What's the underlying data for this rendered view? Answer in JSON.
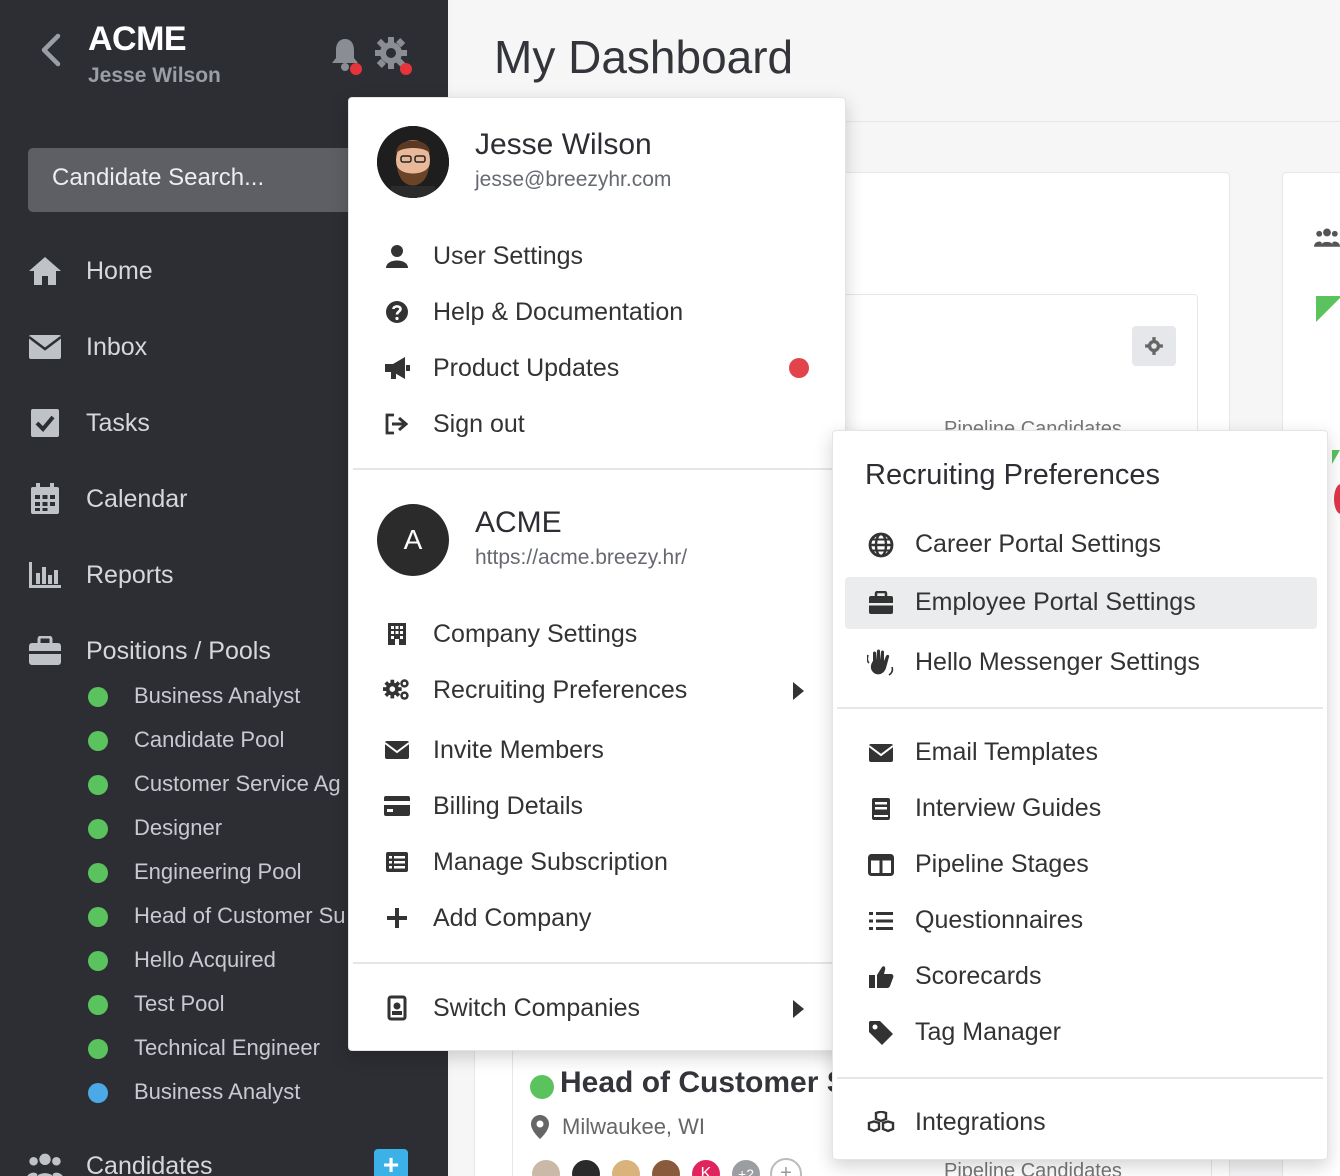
{
  "sidebar": {
    "company": "ACME",
    "user": "Jesse Wilson",
    "search_placeholder": "Candidate Search...",
    "nav": [
      {
        "label": "Home",
        "icon": "home-icon"
      },
      {
        "label": "Inbox",
        "icon": "envelope-icon"
      },
      {
        "label": "Tasks",
        "icon": "checkbox-icon"
      },
      {
        "label": "Calendar",
        "icon": "calendar-icon"
      },
      {
        "label": "Reports",
        "icon": "bar-chart-icon"
      },
      {
        "label": "Positions / Pools",
        "icon": "briefcase-icon"
      }
    ],
    "positions": [
      {
        "label": "Business Analyst",
        "color": "#5ac35e"
      },
      {
        "label": "Candidate Pool",
        "color": "#5ac35e"
      },
      {
        "label": "Customer Service Ag",
        "color": "#5ac35e"
      },
      {
        "label": "Designer",
        "color": "#5ac35e"
      },
      {
        "label": "Engineering Pool",
        "color": "#5ac35e"
      },
      {
        "label": "Head of Customer Su",
        "color": "#5ac35e"
      },
      {
        "label": "Hello Acquired",
        "color": "#5ac35e"
      },
      {
        "label": "Test Pool",
        "color": "#5ac35e"
      },
      {
        "label": "Technical Engineer",
        "color": "#5ac35e"
      },
      {
        "label": "Business Analyst",
        "color": "#4aa9e6"
      }
    ],
    "candidates_label": "Candidates",
    "add_label": "+"
  },
  "main": {
    "title": "My Dashboard",
    "bg_texts": {
      "pipeline_candidates_1": "Pipeline  Candidates",
      "pipeline_candidates_2": "Pipeline  Candidates"
    },
    "position_card": {
      "title": "Head of Customer S",
      "location": "Milwaukee, WI",
      "avatar_k": "K",
      "avatar_more": "+2",
      "avatar_add": "+"
    }
  },
  "user_menu": {
    "name": "Jesse Wilson",
    "email": "jesse@breezyhr.com",
    "items": [
      {
        "label": "User Settings",
        "icon": "user-icon"
      },
      {
        "label": "Help & Documentation",
        "icon": "question-circle-icon"
      },
      {
        "label": "Product Updates",
        "icon": "megaphone-icon"
      },
      {
        "label": "Sign out",
        "icon": "sign-out-icon"
      }
    ],
    "company_initial": "A",
    "company_name": "ACME",
    "company_url": "https://acme.breezy.hr/",
    "company_items": [
      {
        "label": "Company Settings",
        "icon": "building-icon"
      },
      {
        "label": "Recruiting Preferences",
        "icon": "gears-icon"
      },
      {
        "label": "Invite Members",
        "icon": "envelope-icon"
      },
      {
        "label": "Billing Details",
        "icon": "credit-card-icon"
      },
      {
        "label": "Manage Subscription",
        "icon": "list-alt-icon"
      },
      {
        "label": "Add Company",
        "icon": "plus-icon"
      }
    ],
    "switch_label": "Switch Companies"
  },
  "recruiting_menu": {
    "title": "Recruiting Preferences",
    "group1": [
      {
        "label": "Career Portal Settings",
        "icon": "globe-icon"
      },
      {
        "label": "Employee Portal Settings",
        "icon": "briefcase-icon"
      },
      {
        "label": "Hello Messenger Settings",
        "icon": "waving-hand-icon"
      }
    ],
    "group2": [
      {
        "label": "Email Templates",
        "icon": "envelope-icon"
      },
      {
        "label": "Interview Guides",
        "icon": "book-icon"
      },
      {
        "label": "Pipeline Stages",
        "icon": "columns-icon"
      },
      {
        "label": "Questionnaires",
        "icon": "list-icon"
      },
      {
        "label": "Scorecards",
        "icon": "thumbs-up-icon"
      },
      {
        "label": "Tag Manager",
        "icon": "tag-icon"
      }
    ],
    "integrations": {
      "label": "Integrations",
      "icon": "cubes-icon"
    },
    "active_item": "Employee Portal Settings"
  },
  "colors": {
    "sidebar_bg": "#2d2e33",
    "status_green": "#5ac35e",
    "status_blue": "#4aa9e6",
    "notification_red": "#e5343a",
    "accent_blue": "#3bb1e8"
  }
}
